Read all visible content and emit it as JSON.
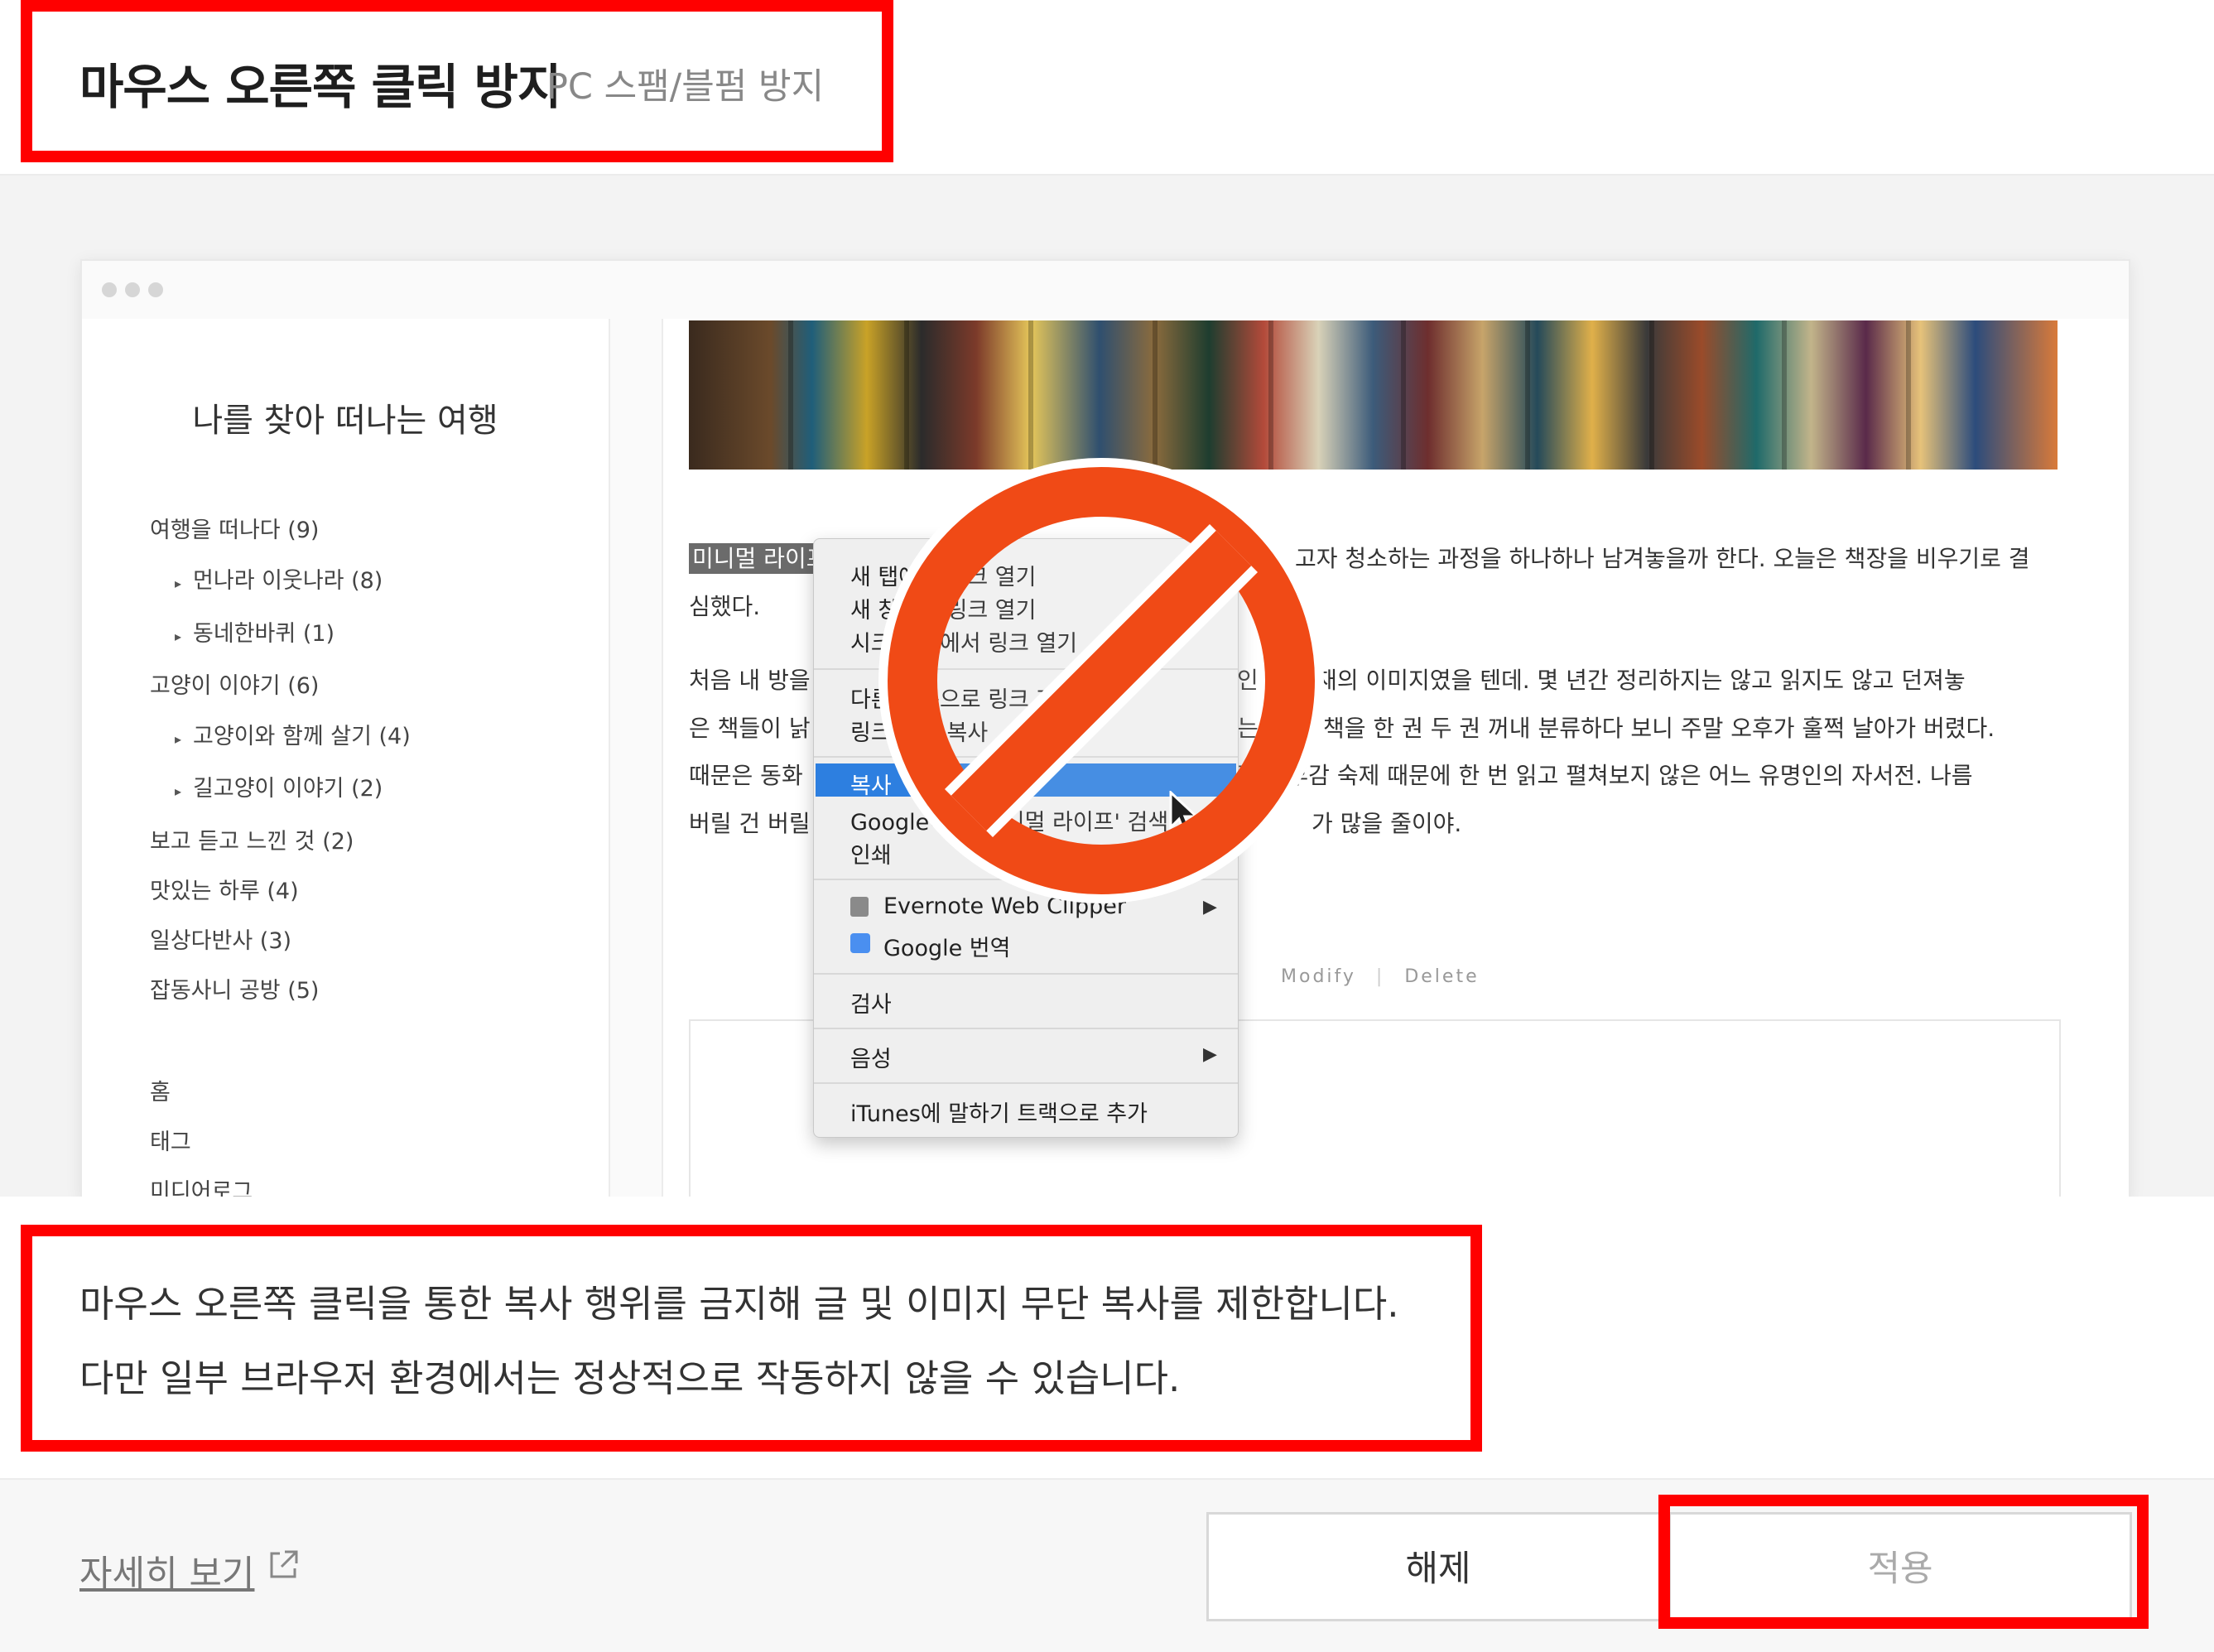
{
  "header": {
    "title": "마우스 오른쪽 클릭 방지",
    "subtitle": "PC 스팸/블펌 방지"
  },
  "preview": {
    "blog_title": "나를 찾아 떠나는 여행",
    "categories": [
      {
        "label": "여행을 떠나다 (9)",
        "sub": false
      },
      {
        "label": "먼나라 이웃나라 (8)",
        "sub": true
      },
      {
        "label": "동네한바퀴 (1)",
        "sub": true
      },
      {
        "label": "고양이 이야기 (6)",
        "sub": false
      },
      {
        "label": "고양이와 함께 살기 (4)",
        "sub": true
      },
      {
        "label": "길고양이 이야기 (2)",
        "sub": true
      },
      {
        "label": "보고 듣고 느낀 것 (2)",
        "sub": false
      },
      {
        "label": "맛있는 하루 (4)",
        "sub": false
      },
      {
        "label": "일상다반사 (3)",
        "sub": false
      },
      {
        "label": "잡동사니 공방 (5)",
        "sub": false
      }
    ],
    "nav_links": [
      "홈",
      "태그",
      "미디어로그"
    ],
    "post": {
      "highlight": "미니멀 라이프",
      "line1_right": "고자 청소하는 과정을 하나하나 남겨놓을까 한다. 오늘은 책장을 비우기로 결",
      "line2": "심했다.",
      "p2_line1_left": "처음 내 방을",
      "p2_line1_right": "인 오     서재의 이미지였을 텐데. 몇 년간 정리하지는 않고 읽지도 않고 던져놓",
      "p2_line2_left": "은 책들이 낡",
      "p2_line2_right": "는 거      로 책을 한 권 두 권 꺼내 분류하다 보니 주말 오후가 훌쩍 날아가 버렸다.",
      "p2_line3_left": "때문은 동화",
      "p2_line3_right": "점     숙후감 숙제 때문에 한 번 읽고 펼쳐보지 않은 어느 유명인의 자서전. 나름",
      "p2_line4_left": "버릴 건 버릴",
      "p2_line4_right": "가 많을 줄이야.",
      "modify": "Modify",
      "divider": "|",
      "delete": "Delete"
    },
    "context_menu": {
      "group1": [
        "새 탭에서 링크 열기",
        "새 창에서 링크 열기",
        "시크릿 창에서 링크 열기"
      ],
      "group2": [
        "다른 이름으로 링크 저장",
        "링크 주소 복사"
      ],
      "selected": "복사",
      "search": "Google에서 '미니멀 라이프' 검색",
      "print": "인쇄",
      "evernote": "Evernote Web Clipper",
      "google_translate": "Google 번역",
      "inspect": "검사",
      "speech": "음성",
      "itunes": "iTunes에 말하기 트랙으로 추가"
    }
  },
  "description": {
    "line1": "마우스 오른쪽 클릭을 통한 복사 행위를 금지해 글 및 이미지 무단 복사를 제한합니다.",
    "line2": "다만 일부 브라우저 환경에서는 정상적으로 작동하지 않을 수 있습니다."
  },
  "footer": {
    "detail_link": "자세히 보기",
    "release_button": "해제",
    "apply_button": "적용"
  },
  "colors": {
    "highlight_box": "#ff0000",
    "menu_selected": "#2d7fe0",
    "prohibition": "#f04a16"
  },
  "icons": [
    "external-link-icon",
    "evernote-icon",
    "google-translate-icon",
    "submenu-arrow-icon",
    "cursor-icon",
    "prohibition-icon"
  ]
}
